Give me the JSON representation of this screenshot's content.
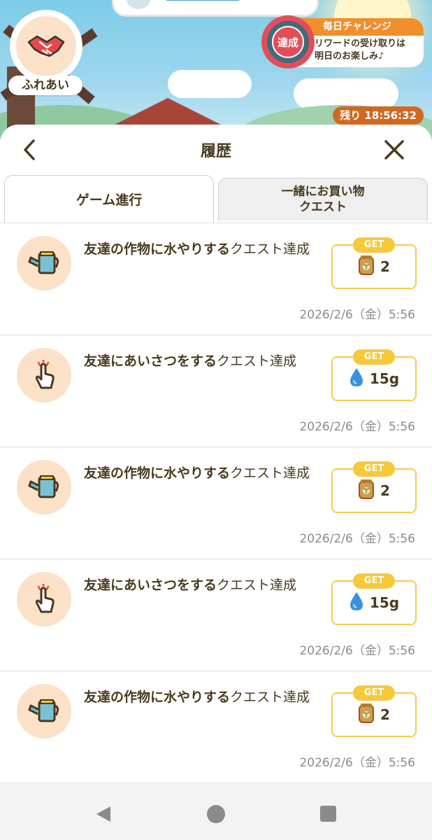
{
  "hud": {
    "fureai_label": "ふれあい",
    "daily": {
      "title": "毎日チャレンジ",
      "badge": "達成",
      "line1": "リワードの受け取りは",
      "line2": "明日のお楽しみ♪"
    },
    "timer": "残り 18:56:32"
  },
  "sheet": {
    "title": "履歴",
    "tabs": [
      {
        "label": "ゲーム進行"
      },
      {
        "label_line1": "一緒にお買い物",
        "label_line2": "クエスト"
      }
    ]
  },
  "entries": [
    {
      "icon": "watering-can-icon",
      "bold": "友達の作物に水やりする",
      "rest": "クエスト達成",
      "get": "GET",
      "reward_icon": "seed-bag-icon",
      "amount": "2",
      "date": "2026/2/6（金）5:56"
    },
    {
      "icon": "tap-hand-icon",
      "bold": "友達にあいさつをする",
      "rest": "クエスト達成",
      "get": "GET",
      "reward_icon": "water-drop-icon",
      "amount": "15g",
      "date": "2026/2/6（金）5:56"
    },
    {
      "icon": "watering-can-icon",
      "bold": "友達の作物に水やりする",
      "rest": "クエスト達成",
      "get": "GET",
      "reward_icon": "seed-bag-icon",
      "amount": "2",
      "date": "2026/2/6（金）5:56"
    },
    {
      "icon": "tap-hand-icon",
      "bold": "友達にあいさつをする",
      "rest": "クエスト達成",
      "get": "GET",
      "reward_icon": "water-drop-icon",
      "amount": "15g",
      "date": "2026/2/6（金）5:56"
    },
    {
      "icon": "watering-can-icon",
      "bold": "友達の作物に水やりする",
      "rest": "クエスト達成",
      "get": "GET",
      "reward_icon": "seed-bag-icon",
      "amount": "2",
      "date": "2026/2/6（金）5:56"
    }
  ],
  "colors": {
    "accent_orange": "#f08f2c",
    "get_yellow": "#f5c93a",
    "text_brown": "#4a3a1e",
    "icon_bg": "#fbe1c8"
  }
}
